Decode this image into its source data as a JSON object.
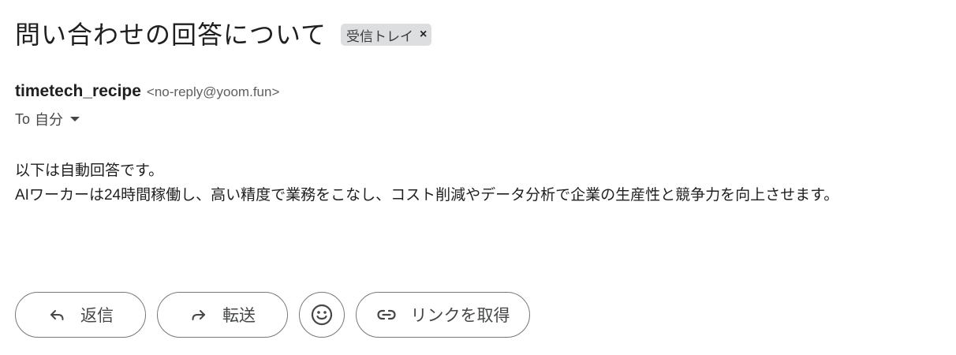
{
  "email": {
    "subject": "問い合わせの回答について",
    "label": "受信トレイ",
    "label_close": "×",
    "sender_name": "timetech_recipe",
    "sender_email": "<no-reply@yoom.fun>",
    "to_prefix": "To",
    "to_value": "自分",
    "body_lines": [
      "以下は自動回答です。",
      "AIワーカーは24時間稼働し、高い精度で業務をこなし、コスト削減やデータ分析で企業の生産性と競争力を向上させます。"
    ]
  },
  "actions": {
    "reply_label": "返信",
    "forward_label": "転送",
    "emoji_icon": "emoji-smile-icon",
    "link_label": "リンクを取得"
  },
  "colors": {
    "chip_bg": "#dddedf",
    "button_border": "#747775",
    "text_primary": "#1f1f1f",
    "text_secondary": "#444746"
  }
}
